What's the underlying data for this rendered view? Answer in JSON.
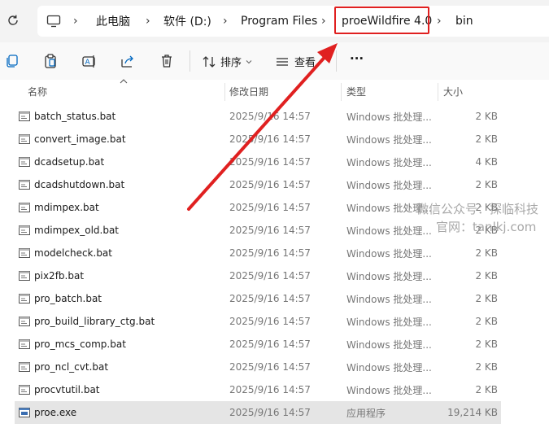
{
  "breadcrumb": {
    "items": [
      "此电脑",
      "软件 (D:)",
      "Program Files",
      "proeWildfire 4.0",
      "bin"
    ]
  },
  "toolbar": {
    "icons": [
      "copy-icon",
      "paste-icon",
      "rename-icon",
      "share-icon",
      "delete-icon"
    ],
    "sort_label": "排序",
    "view_label": "查看",
    "more_label": "···"
  },
  "columns": {
    "name": "名称",
    "date": "修改日期",
    "type": "类型",
    "size": "大小"
  },
  "files": [
    {
      "name": "batch_status.bat",
      "date": "2025/9/16 14:57",
      "type": "Windows 批处理...",
      "size": "2 KB"
    },
    {
      "name": "convert_image.bat",
      "date": "2025/9/16 14:57",
      "type": "Windows 批处理...",
      "size": "2 KB"
    },
    {
      "name": "dcadsetup.bat",
      "date": "2025/9/16 14:57",
      "type": "Windows 批处理...",
      "size": "4 KB"
    },
    {
      "name": "dcadshutdown.bat",
      "date": "2025/9/16 14:57",
      "type": "Windows 批处理...",
      "size": "2 KB"
    },
    {
      "name": "mdimpex.bat",
      "date": "2025/9/16 14:57",
      "type": "Windows 批处理...",
      "size": "2 KB"
    },
    {
      "name": "mdimpex_old.bat",
      "date": "2025/9/16 14:57",
      "type": "Windows 批处理...",
      "size": "2 KB"
    },
    {
      "name": "modelcheck.bat",
      "date": "2025/9/16 14:57",
      "type": "Windows 批处理...",
      "size": "2 KB"
    },
    {
      "name": "pix2fb.bat",
      "date": "2025/9/16 14:57",
      "type": "Windows 批处理...",
      "size": "2 KB"
    },
    {
      "name": "pro_batch.bat",
      "date": "2025/9/16 14:57",
      "type": "Windows 批处理...",
      "size": "2 KB"
    },
    {
      "name": "pro_build_library_ctg.bat",
      "date": "2025/9/16 14:57",
      "type": "Windows 批处理...",
      "size": "2 KB"
    },
    {
      "name": "pro_mcs_comp.bat",
      "date": "2025/9/16 14:57",
      "type": "Windows 批处理...",
      "size": "2 KB"
    },
    {
      "name": "pro_ncl_cvt.bat",
      "date": "2025/9/16 14:57",
      "type": "Windows 批处理...",
      "size": "2 KB"
    },
    {
      "name": "procvtutil.bat",
      "date": "2025/9/16 14:57",
      "type": "Windows 批处理...",
      "size": "2 KB"
    },
    {
      "name": "proe.exe",
      "date": "2025/9/16 14:57",
      "type": "应用程序",
      "size": "19,214 KB"
    }
  ],
  "watermark": {
    "line1": "微信公众号：探临科技",
    "line2": "官网：tanlkj.com"
  },
  "colors": {
    "highlight": "#e02020",
    "selected_row": "#e5e5e5",
    "accent": "#0067c0"
  }
}
